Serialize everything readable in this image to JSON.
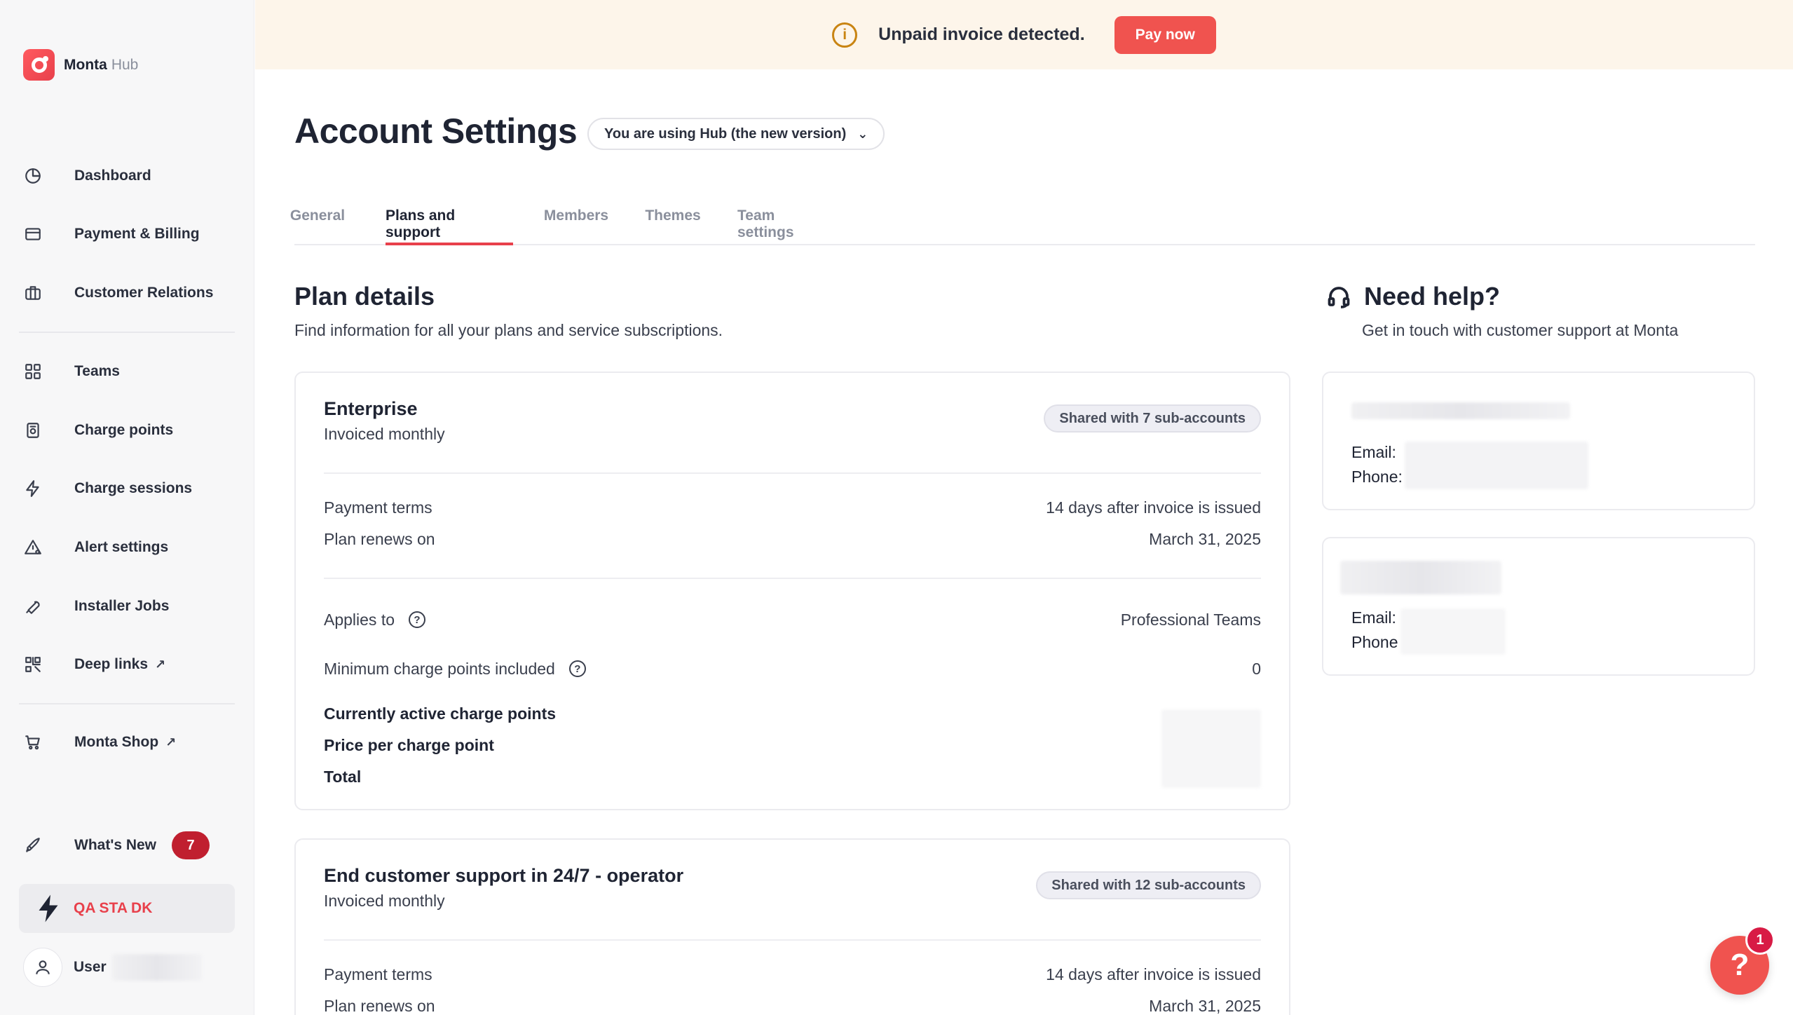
{
  "brand": {
    "name": "Monta",
    "sub": "Hub"
  },
  "sidebar": {
    "items": [
      {
        "label": "Dashboard",
        "icon": "pie-chart-icon"
      },
      {
        "label": "Payment & Billing",
        "icon": "credit-card-icon"
      },
      {
        "label": "Customer Relations",
        "icon": "briefcase-icon"
      },
      {
        "label": "Teams",
        "icon": "grid-icon"
      },
      {
        "label": "Charge points",
        "icon": "charger-icon"
      },
      {
        "label": "Charge sessions",
        "icon": "lightning-icon"
      },
      {
        "label": "Alert settings",
        "icon": "alert-triangle-icon"
      },
      {
        "label": "Installer Jobs",
        "icon": "wrench-icon"
      },
      {
        "label": "Deep links",
        "icon": "qr-code-icon",
        "external": "↗"
      },
      {
        "label": "Monta Shop",
        "icon": "cart-icon",
        "external": "↗"
      },
      {
        "label": "What's New",
        "icon": "rocket-icon",
        "badge": "7"
      }
    ],
    "account": "QA STA DK",
    "user": "User"
  },
  "banner": {
    "text": "Unpaid invoice detected.",
    "button": "Pay now",
    "icon_glyph": "i"
  },
  "header": {
    "title": "Account Settings",
    "version": "You are using Hub (the new version)"
  },
  "tabs": [
    "General",
    "Plans and support",
    "Members",
    "Themes",
    "Team settings"
  ],
  "plan_section": {
    "title": "Plan details",
    "subtitle": "Find information for all your plans and service subscriptions."
  },
  "plans": [
    {
      "name": "Enterprise",
      "billing": "Invoiced monthly",
      "shared": "Shared with 7 sub-accounts",
      "payment_terms_label": "Payment terms",
      "payment_terms_value": "14 days after invoice is issued",
      "renews_label": "Plan renews on",
      "renews_value": "March 31, 2025",
      "applies_label": "Applies to",
      "applies_value": "Professional Teams",
      "min_label": "Minimum charge points included",
      "min_value": "0",
      "active_label": "Currently active charge points",
      "price_label": "Price per charge point",
      "total_label": "Total"
    },
    {
      "name": "End customer support in 24/7 - operator",
      "billing": "Invoiced monthly",
      "shared": "Shared with 12 sub-accounts",
      "payment_terms_label": "Payment terms",
      "payment_terms_value": "14 days after invoice is issued",
      "renews_label": "Plan renews on",
      "renews_value": "March 31, 2025"
    }
  ],
  "help": {
    "title": "Need help?",
    "subtitle": "Get in touch with customer support at Monta",
    "contacts": [
      {
        "email_label": "Email:",
        "phone_label": "Phone:"
      },
      {
        "email_label": "Email:",
        "phone_label": "Phone"
      }
    ]
  },
  "fab": {
    "glyph": "?",
    "badge": "1"
  },
  "colors": {
    "accent": "#e8404b",
    "banner_bg": "#fdf5ea",
    "badge": "#c01f2f"
  }
}
